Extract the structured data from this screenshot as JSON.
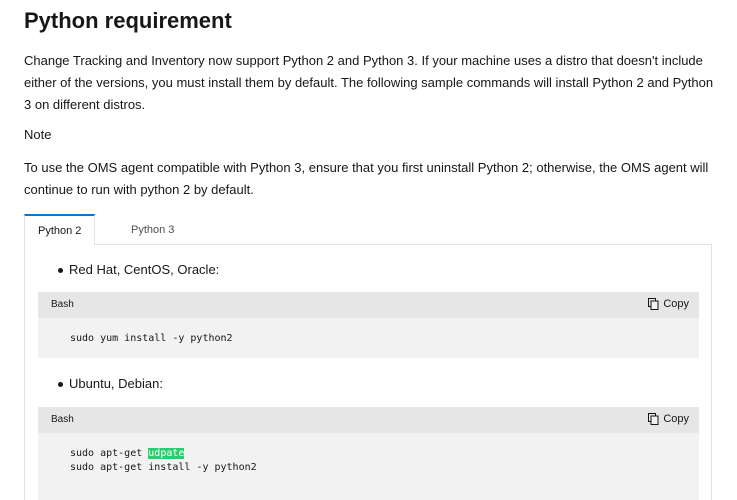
{
  "heading": "Python requirement",
  "intro": "Change Tracking and Inventory now support Python 2 and Python 3. If your machine uses a distro that doesn't include either of the versions, you must install them by default. The following sample commands will install Python 2 and Python 3 on different distros.",
  "note_label": "Note",
  "oms_text": "To use the OMS agent compatible with Python 3, ensure that you first uninstall Python 2; otherwise, the OMS agent will continue to run with python 2 by default.",
  "tabs": [
    {
      "label": "Python 2",
      "active": true
    },
    {
      "label": "Python 3",
      "active": false
    }
  ],
  "sections": [
    {
      "bullet": "Red Hat, CentOS, Oracle:",
      "code_lang": "Bash",
      "copy_label": "Copy",
      "lines": [
        "sudo yum install -y python2"
      ]
    },
    {
      "bullet": "Ubuntu, Debian:",
      "code_lang": "Bash",
      "copy_label": "Copy",
      "line1_prefix": "sudo apt-get ",
      "line1_highlight": "udpate",
      "line2": "sudo apt-get install -y python2"
    }
  ],
  "colors": {
    "tab_accent": "#0078d4",
    "code_bg": "#f2f2f2",
    "code_header_bg": "#e6e6e6",
    "highlight": "#2ecc71"
  }
}
